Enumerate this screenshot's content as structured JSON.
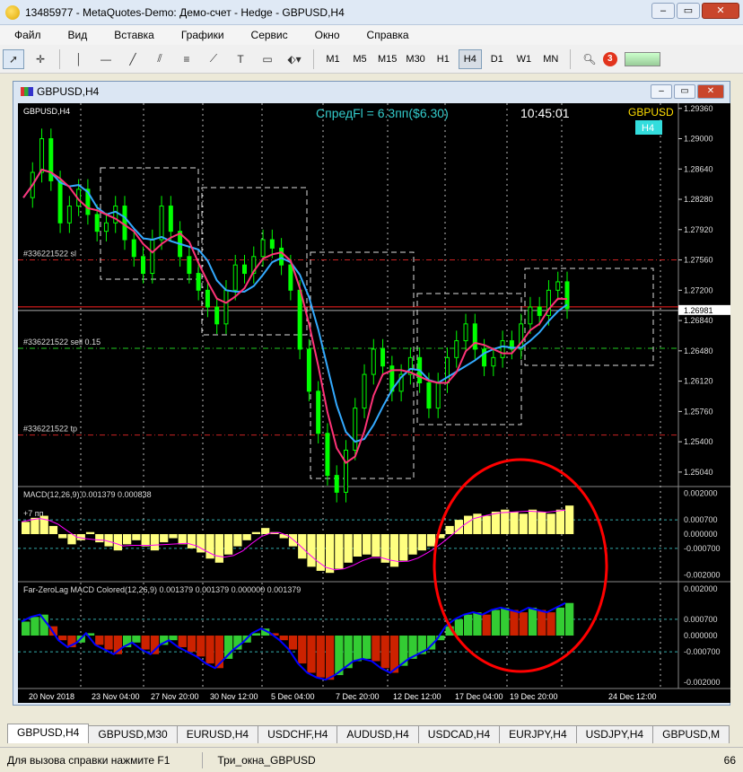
{
  "window": {
    "title": "13485977 - MetaQuotes-Demo: Демо-счет - Hedge - GBPUSD,H4"
  },
  "menu": [
    "Файл",
    "Вид",
    "Вставка",
    "Графики",
    "Сервис",
    "Окно",
    "Справка"
  ],
  "timeframes": [
    "M1",
    "M5",
    "M15",
    "M30",
    "H1",
    "H4",
    "D1",
    "W1",
    "MN"
  ],
  "selected_timeframe": "H4",
  "notifications_count": "3",
  "chart_window": {
    "title": "GBPUSD,H4",
    "symbol_label": "GBPUSD,H4",
    "spread_text": "СпредFl = 6.3пп($6.30)",
    "time_text": "10:45:01",
    "symbol_corner": "GBPUSD",
    "tf_corner": "H4",
    "price_ticks": [
      "1.29360",
      "1.29000",
      "1.28640",
      "1.28280",
      "1.27920",
      "1.27560",
      "1.27200",
      "1.26840",
      "1.26480",
      "1.26120",
      "1.25760",
      "1.25400",
      "1.25040"
    ],
    "current_price": "1.26981",
    "order_labels": {
      "sl": "#336221522 sl",
      "sell": "#336221522 sell 0.15",
      "tp": "#336221522 tp"
    },
    "macd": {
      "title": "MACD(12,26,9) 0.001379 0.000838",
      "note": "+7 пп",
      "ticks": [
        "0.002000",
        "0.000700",
        "0.000000",
        "-0.000700",
        "-0.002000"
      ]
    },
    "zerolag": {
      "title": "Far-ZeroLag MACD Colored(12,26,9) 0.001379 0.001379 0.000000 0.001379",
      "ticks": [
        "0.002000",
        "0.000700",
        "0.000000",
        "-0.000700",
        "-0.002000"
      ]
    },
    "time_labels": [
      "20 Nov 2018",
      "23 Nov 04:00",
      "27 Nov 20:00",
      "30 Nov 12:00",
      "5 Dec 04:00",
      "7 Dec 20:00",
      "12 Dec 12:00",
      "17 Dec 04:00",
      "19 Dec 20:00",
      "24 Dec 12:00"
    ]
  },
  "tabs": [
    "GBPUSD,H4",
    "GBPUSD,M30",
    "EURUSD,H4",
    "USDCHF,H4",
    "AUDUSD,H4",
    "USDCAD,H4",
    "EURJPY,H4",
    "USDJPY,H4",
    "GBPUSD,M"
  ],
  "status": {
    "help": "Для вызова справки нажмите F1",
    "profile": "Три_окна_GBPUSD",
    "right": "66"
  },
  "colors": {
    "bg": "#000000",
    "bull_candle": "#00ff00",
    "macd_hist": "#ffff80",
    "signal": "#ff00ff",
    "zl_green": "#33cc33",
    "zl_red": "#cc2200",
    "zl_line": "#0000ff",
    "ma_blue": "#33aaff",
    "ma_pink": "#ff3377",
    "ellipse": "#ff0000",
    "spread": "#33cccc"
  },
  "chart_data": {
    "type": "candlestick",
    "symbol": "GBPUSD",
    "timeframe": "H4",
    "close_series": [
      1.283,
      1.286,
      1.29,
      1.285,
      1.28,
      1.282,
      1.284,
      1.281,
      1.279,
      1.28,
      1.282,
      1.278,
      1.276,
      1.274,
      1.278,
      1.282,
      1.279,
      1.276,
      1.274,
      1.272,
      1.27,
      1.268,
      1.272,
      1.275,
      1.274,
      1.276,
      1.278,
      1.277,
      1.275,
      1.272,
      1.265,
      1.26,
      1.255,
      1.25,
      1.248,
      1.253,
      1.258,
      1.262,
      1.265,
      1.263,
      1.26,
      1.262,
      1.264,
      1.261,
      1.258,
      1.261,
      1.264,
      1.266,
      1.268,
      1.265,
      1.263,
      1.264,
      1.266,
      1.265,
      1.268,
      1.27,
      1.269,
      1.272,
      1.273,
      1.2698
    ],
    "ylim": [
      1.249,
      1.294
    ],
    "current_price": 1.26981,
    "macd_hist": [
      0.0006,
      0.0008,
      0.0009,
      0.0004,
      -0.0002,
      -0.0005,
      -0.0003,
      0.0001,
      -0.0004,
      -0.0006,
      -0.0008,
      -0.0005,
      -0.0003,
      -0.0006,
      -0.0008,
      -0.0004,
      -0.0002,
      -0.0005,
      -0.0007,
      -0.0009,
      -0.0012,
      -0.0014,
      -0.001,
      -0.0006,
      -0.0003,
      0.0001,
      0.0003,
      0.0001,
      -0.0002,
      -0.0006,
      -0.0012,
      -0.0016,
      -0.0018,
      -0.0019,
      -0.0017,
      -0.0014,
      -0.0011,
      -0.001,
      -0.0011,
      -0.0014,
      -0.0016,
      -0.0013,
      -0.001,
      -0.0008,
      -0.0006,
      -0.0002,
      0.0004,
      0.0007,
      0.0009,
      0.001,
      0.0009,
      0.0011,
      0.0012,
      0.0011,
      0.001,
      0.0012,
      0.0011,
      0.001,
      0.0012,
      0.0014
    ],
    "macd_ylim": [
      -0.0022,
      0.0022
    ]
  }
}
